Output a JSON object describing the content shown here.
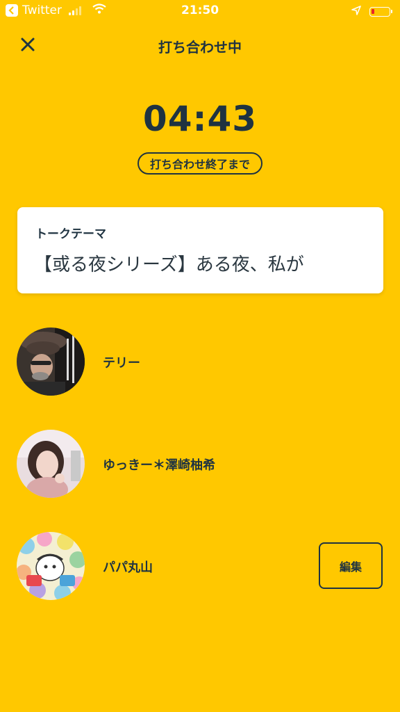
{
  "status_bar": {
    "back_app": "Twitter",
    "time": "21:50"
  },
  "header": {
    "title": "打ち合わせ中"
  },
  "timer": {
    "value": "04:43",
    "caption": "打ち合わせ終了まで"
  },
  "topic": {
    "label": "トークテーマ",
    "text": "【或る夜シリーズ】ある夜、私が"
  },
  "participants": [
    {
      "name": "テリー"
    },
    {
      "name": "ゆっきー＊澤崎柚希"
    },
    {
      "name": "パパ丸山",
      "action_label": "編集"
    }
  ],
  "colors": {
    "background": "#FFC800",
    "text": "#1F3341",
    "card": "#FFFFFF"
  }
}
